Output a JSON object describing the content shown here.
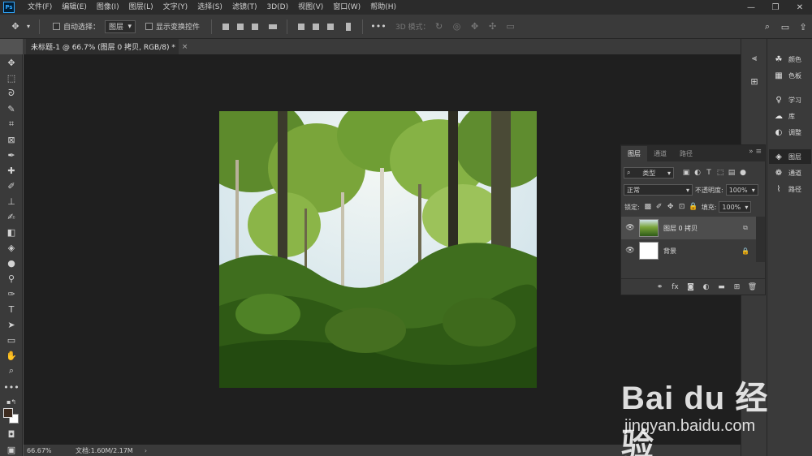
{
  "app": {
    "logo": "Ps"
  },
  "menu": [
    "文件(F)",
    "编辑(E)",
    "图像(I)",
    "图层(L)",
    "文字(Y)",
    "选择(S)",
    "滤镜(T)",
    "3D(D)",
    "视图(V)",
    "窗口(W)",
    "帮助(H)"
  ],
  "window_controls": {
    "minimize": "—",
    "restore": "❐",
    "close": "✕"
  },
  "options": {
    "auto_select_label": "自动选择：",
    "auto_select_value": "图层",
    "show_transform_label": "显示变换控件",
    "mode_3d_label": "3D 模式：",
    "more": "•••"
  },
  "document_tab": {
    "title": "未标题-1 @ 66.7% (图层 0 拷贝, RGB/8) *",
    "close": "×"
  },
  "status": {
    "zoom": "66.67%",
    "doc": "文档:1.60M/2.17M",
    "arrow": "›"
  },
  "side_panels": [
    {
      "label": "颜色",
      "icon": "palette-icon"
    },
    {
      "label": "色板",
      "icon": "grid-icon"
    },
    {
      "label": "学习",
      "icon": "lightbulb-icon"
    },
    {
      "label": "库",
      "icon": "cc-libraries-icon"
    },
    {
      "label": "调整",
      "icon": "adjust-icon"
    },
    {
      "label": "图层",
      "icon": "layers-icon"
    },
    {
      "label": "通道",
      "icon": "channels-icon"
    },
    {
      "label": "路径",
      "icon": "paths-icon"
    }
  ],
  "layers_panel": {
    "tabs": [
      "图层",
      "通道",
      "路径"
    ],
    "active_tab": "图层",
    "filter_kind": "类型",
    "blend_mode": "正常",
    "opacity_label": "不透明度:",
    "opacity_value": "100%",
    "lock_label": "锁定:",
    "fill_label": "填充:",
    "fill_value": "100%",
    "layers": [
      {
        "name": "图层 0 拷贝",
        "visible": true,
        "selected": true,
        "badge": "smart-object-icon"
      },
      {
        "name": "背景",
        "visible": true,
        "selected": false,
        "badge": "lock-icon"
      }
    ]
  },
  "watermark": {
    "main": "Bai du 经验",
    "sub": "jingyan.baidu.com"
  }
}
